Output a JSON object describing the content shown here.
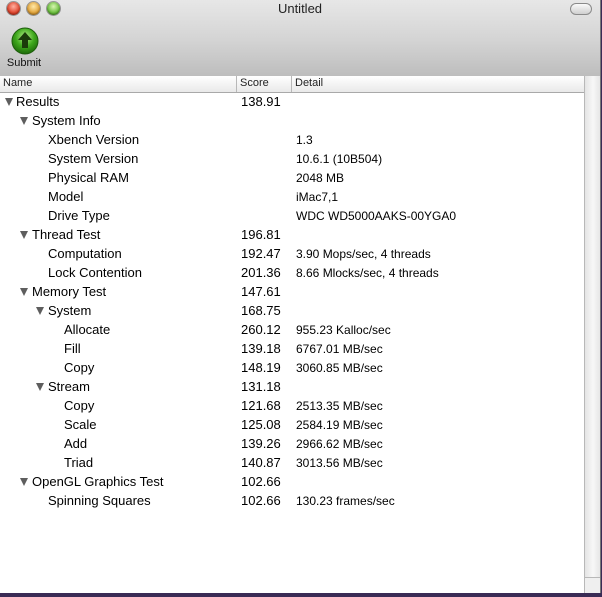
{
  "window": {
    "title": "Untitled"
  },
  "toolbar": {
    "submit_label": "Submit"
  },
  "columns": {
    "name": "Name",
    "score": "Score",
    "detail": "Detail"
  },
  "rows": [
    {
      "name": "Results",
      "score": "138.91",
      "detail": ""
    },
    {
      "name": "System Info",
      "score": "",
      "detail": ""
    },
    {
      "name": "Xbench Version",
      "score": "",
      "detail": "1.3"
    },
    {
      "name": "System Version",
      "score": "",
      "detail": "10.6.1 (10B504)"
    },
    {
      "name": "Physical RAM",
      "score": "",
      "detail": "2048 MB"
    },
    {
      "name": "Model",
      "score": "",
      "detail": "iMac7,1"
    },
    {
      "name": "Drive Type",
      "score": "",
      "detail": "WDC WD5000AAKS-00YGA0"
    },
    {
      "name": "Thread Test",
      "score": "196.81",
      "detail": ""
    },
    {
      "name": "Computation",
      "score": "192.47",
      "detail": "3.90 Mops/sec, 4 threads"
    },
    {
      "name": "Lock Contention",
      "score": "201.36",
      "detail": "8.66 Mlocks/sec, 4 threads"
    },
    {
      "name": "Memory Test",
      "score": "147.61",
      "detail": ""
    },
    {
      "name": "System",
      "score": "168.75",
      "detail": ""
    },
    {
      "name": "Allocate",
      "score": "260.12",
      "detail": "955.23 Kalloc/sec"
    },
    {
      "name": "Fill",
      "score": "139.18",
      "detail": "6767.01 MB/sec"
    },
    {
      "name": "Copy",
      "score": "148.19",
      "detail": "3060.85 MB/sec"
    },
    {
      "name": "Stream",
      "score": "131.18",
      "detail": ""
    },
    {
      "name": "Copy",
      "score": "121.68",
      "detail": "2513.35 MB/sec"
    },
    {
      "name": "Scale",
      "score": "125.08",
      "detail": "2584.19 MB/sec"
    },
    {
      "name": "Add",
      "score": "139.26",
      "detail": "2966.62 MB/sec"
    },
    {
      "name": "Triad",
      "score": "140.87",
      "detail": "3013.56 MB/sec"
    },
    {
      "name": "OpenGL Graphics Test",
      "score": "102.66",
      "detail": ""
    },
    {
      "name": "Spinning Squares",
      "score": "102.66",
      "detail": "130.23 frames/sec"
    }
  ]
}
